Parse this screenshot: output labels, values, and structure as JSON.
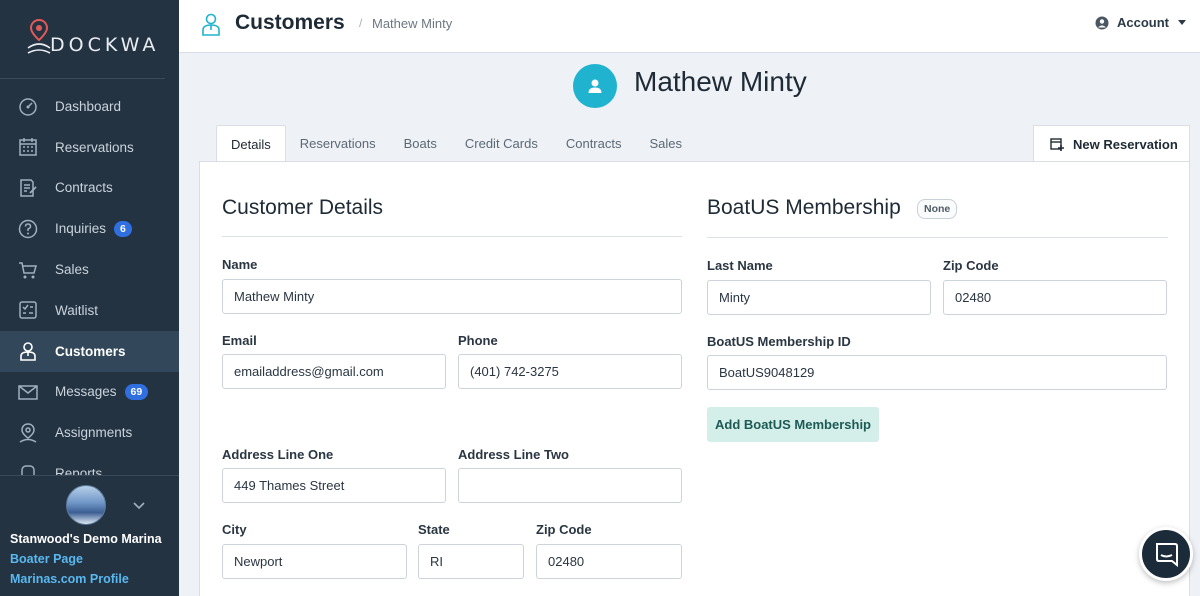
{
  "brand": {
    "name": "DOCKWA"
  },
  "sidebar": {
    "items": [
      {
        "label": "Dashboard",
        "icon": "dashboard-icon",
        "badge": null,
        "active": false
      },
      {
        "label": "Reservations",
        "icon": "calendar-icon",
        "badge": null,
        "active": false
      },
      {
        "label": "Contracts",
        "icon": "contract-icon",
        "badge": null,
        "active": false
      },
      {
        "label": "Inquiries",
        "icon": "question-icon",
        "badge": "6",
        "active": false
      },
      {
        "label": "Sales",
        "icon": "cart-icon",
        "badge": null,
        "active": false
      },
      {
        "label": "Waitlist",
        "icon": "waitlist-icon",
        "badge": null,
        "active": false
      },
      {
        "label": "Customers",
        "icon": "customer-icon",
        "badge": null,
        "active": true
      },
      {
        "label": "Messages",
        "icon": "envelope-icon",
        "badge": "69",
        "active": false
      },
      {
        "label": "Assignments",
        "icon": "location-pin-icon",
        "badge": null,
        "active": false
      },
      {
        "label": "Reports",
        "icon": "reports-icon",
        "badge": null,
        "active": false
      }
    ],
    "marina_name": "Stanwood's Demo Marina",
    "links": {
      "boater_page": "Boater Page",
      "marinas_profile": "Marinas.com Profile"
    }
  },
  "header": {
    "title": "Customers",
    "breadcrumb_sep": "/",
    "breadcrumb": "Mathew Minty",
    "account_label": "Account"
  },
  "customer": {
    "name": "Mathew Minty"
  },
  "tabs": [
    {
      "label": "Details",
      "active": true
    },
    {
      "label": "Reservations",
      "active": false
    },
    {
      "label": "Boats",
      "active": false
    },
    {
      "label": "Credit Cards",
      "active": false
    },
    {
      "label": "Contracts",
      "active": false
    },
    {
      "label": "Sales",
      "active": false
    }
  ],
  "new_reservation_label": "New Reservation",
  "details": {
    "title": "Customer Details",
    "name_label": "Name",
    "name_value": "Mathew Minty",
    "email_label": "Email",
    "email_value": "emailaddress@gmail.com",
    "phone_label": "Phone",
    "phone_value": "(401) 742-3275",
    "address1_label": "Address Line One",
    "address1_value": "449 Thames Street",
    "address2_label": "Address Line Two",
    "address2_value": "",
    "city_label": "City",
    "city_value": "Newport",
    "state_label": "State",
    "state_value": "RI",
    "zip_label": "Zip Code",
    "zip_value": "02480"
  },
  "boatus": {
    "title": "BoatUS Membership",
    "status_badge": "None",
    "last_name_label": "Last Name",
    "last_name_value": "Minty",
    "zip_label": "Zip Code",
    "zip_value": "02480",
    "membership_id_label": "BoatUS Membership ID",
    "membership_id_value": "BoatUS9048129",
    "add_button_label": "Add BoatUS Membership"
  },
  "colors": {
    "sidebar_bg": "#243342",
    "accent_teal": "#1fb3cf",
    "badge_blue": "#2f6fe0",
    "link_blue": "#59b8ef",
    "add_button_bg": "#d4efea"
  }
}
